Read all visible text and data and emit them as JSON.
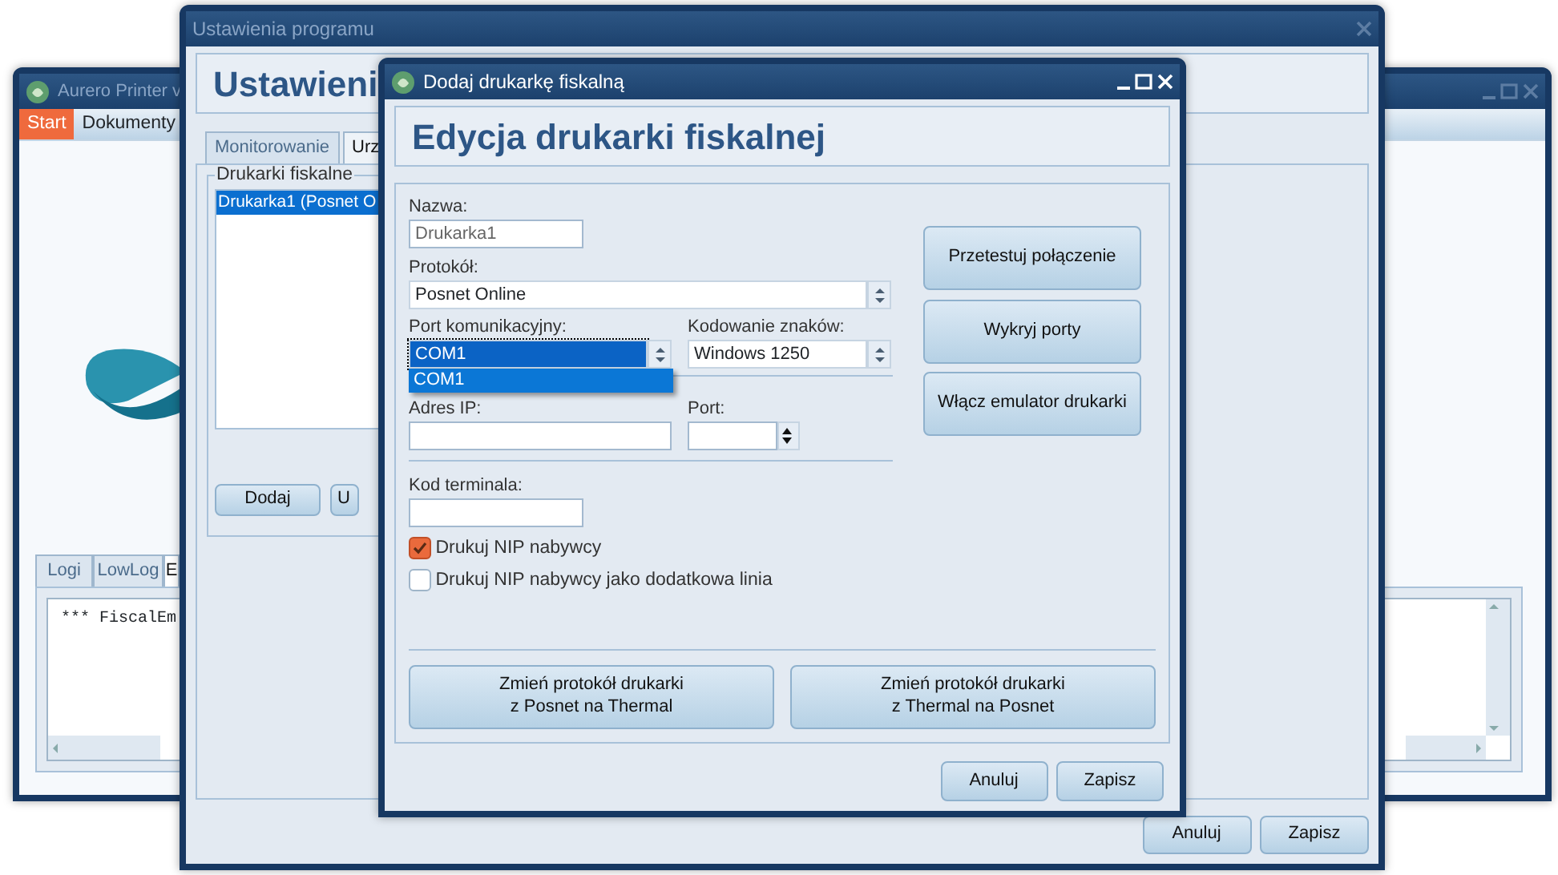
{
  "desktop_window": {
    "title": "Aurero Printer v",
    "menu_tabs": [
      {
        "label": "Start",
        "selected": true
      },
      {
        "label": "Dokumenty",
        "selected": false
      }
    ],
    "log_tabs": [
      {
        "label": "Logi",
        "selected": false
      },
      {
        "label": "LowLog",
        "selected": false
      },
      {
        "label": "E",
        "selected": true
      }
    ],
    "log_text": "*** FiscalEm"
  },
  "settings_window": {
    "title": "Ustawienia programu",
    "heading": "Ustawieni",
    "tabs": [
      {
        "label": "Monitorowanie",
        "selected": false
      },
      {
        "label": "Urz",
        "selected": true
      }
    ],
    "group_title": "Drukarki fiskalne",
    "printers": [
      {
        "label": "Drukarka1 (Posnet O",
        "selected": true
      }
    ],
    "list_buttons": [
      "Dodaj",
      "U"
    ],
    "footer_buttons": [
      "Anuluj",
      "Zapisz"
    ]
  },
  "dialog": {
    "title": "Dodaj drukarkę fiskalną",
    "heading": "Edycja drukarki fiskalnej",
    "name": {
      "label": "Nazwa:",
      "value": "Drukarka1",
      "disabled": true
    },
    "protocol": {
      "label": "Protokół:",
      "value": "Posnet Online"
    },
    "port": {
      "label": "Port komunikacyjny:",
      "value": "COM1",
      "expanded": true,
      "options": [
        {
          "label": "COM1",
          "selected": true
        }
      ]
    },
    "encoding": {
      "label": "Kodowanie znaków:",
      "value": "Windows 1250"
    },
    "ip_address": {
      "label": "Adres IP:"
    },
    "ip_port": {
      "label": "Port:"
    },
    "terminal_code": {
      "label": "Kod terminala:"
    },
    "checkboxes": [
      {
        "label": "Drukuj NIP nabywcy",
        "checked": true
      },
      {
        "label": "Drukuj NIP nabywcy jako dodatkowa linia",
        "checked": false
      }
    ],
    "side_buttons": [
      "Przetestuj połączenie",
      "Wykryj porty",
      "Włącz emulator drukarki"
    ],
    "protocol_buttons": [
      "Zmień protokół drukarki\nz Posnet na Thermal",
      "Zmień protokół drukarki\nz Thermal na Posnet"
    ],
    "footer_buttons": [
      "Anuluj",
      "Zapisz"
    ]
  }
}
